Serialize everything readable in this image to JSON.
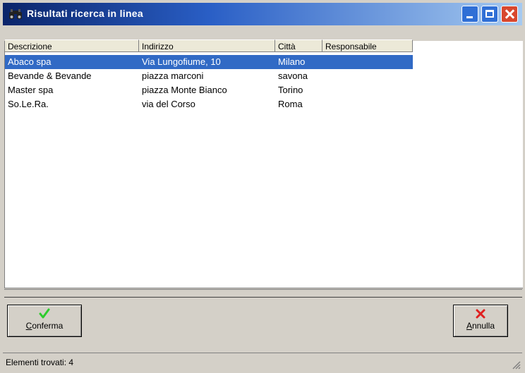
{
  "window": {
    "title": "Risultati ricerca in linea"
  },
  "list": {
    "columns": [
      "Descrizione",
      "Indirizzo",
      "Città",
      "Responsabile"
    ],
    "rows": [
      {
        "descrizione": "Abaco spa",
        "indirizzo": "Via Lungofiume, 10",
        "citta": "Milano",
        "responsabile": "",
        "selected": true
      },
      {
        "descrizione": "Bevande & Bevande",
        "indirizzo": "piazza marconi",
        "citta": "savona",
        "responsabile": "",
        "selected": false
      },
      {
        "descrizione": "Master spa",
        "indirizzo": "piazza Monte Bianco",
        "citta": "Torino",
        "responsabile": "",
        "selected": false
      },
      {
        "descrizione": "So.Le.Ra.",
        "indirizzo": "via del Corso",
        "citta": "Roma",
        "responsabile": "",
        "selected": false
      }
    ]
  },
  "buttons": {
    "confirm": {
      "mnemonic": "C",
      "rest": "onferma",
      "icon": "check-icon",
      "icon_color": "#2ecc2e"
    },
    "cancel": {
      "mnemonic": "A",
      "rest": "nnulla",
      "icon": "x-icon",
      "icon_color": "#e02020"
    }
  },
  "status": {
    "text": "Elementi trovati: 4"
  },
  "colors": {
    "selection": "#316ac5",
    "titlebar_start": "#0a246a",
    "titlebar_end": "#a6caf0"
  }
}
